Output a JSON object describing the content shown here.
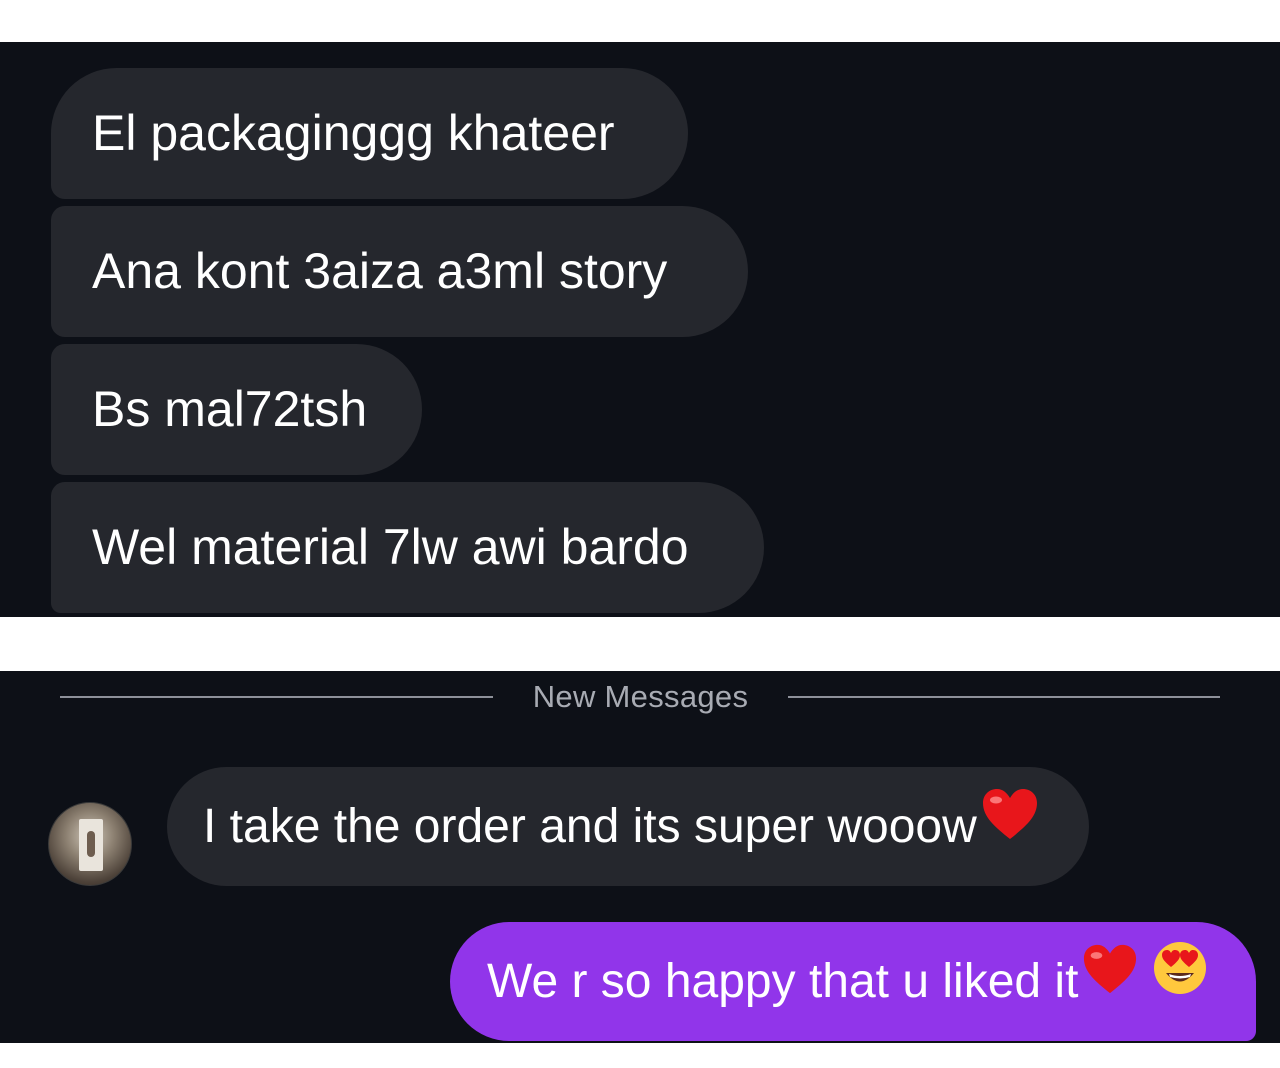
{
  "screenshot_top": {
    "messages": [
      {
        "text": "El packaginggg khateer"
      },
      {
        "text": "Ana kont 3aiza a3ml story"
      },
      {
        "text": "Bs mal72tsh"
      },
      {
        "text": "Wel material 7lw awi bardo"
      }
    ]
  },
  "screenshot_bottom": {
    "divider": {
      "label": "New Messages"
    },
    "incoming": {
      "text": "I take the order and its super wooow",
      "emoji": "red-heart-icon"
    },
    "outgoing": {
      "text": "We r so happy that u liked it",
      "emojis": [
        "red-heart-icon",
        "heart-eyes-face-icon"
      ]
    }
  },
  "colors": {
    "background": "#0d1017",
    "incoming_bubble": "#25272d",
    "outgoing_bubble": "#9135ea",
    "divider": "#8d9099"
  }
}
